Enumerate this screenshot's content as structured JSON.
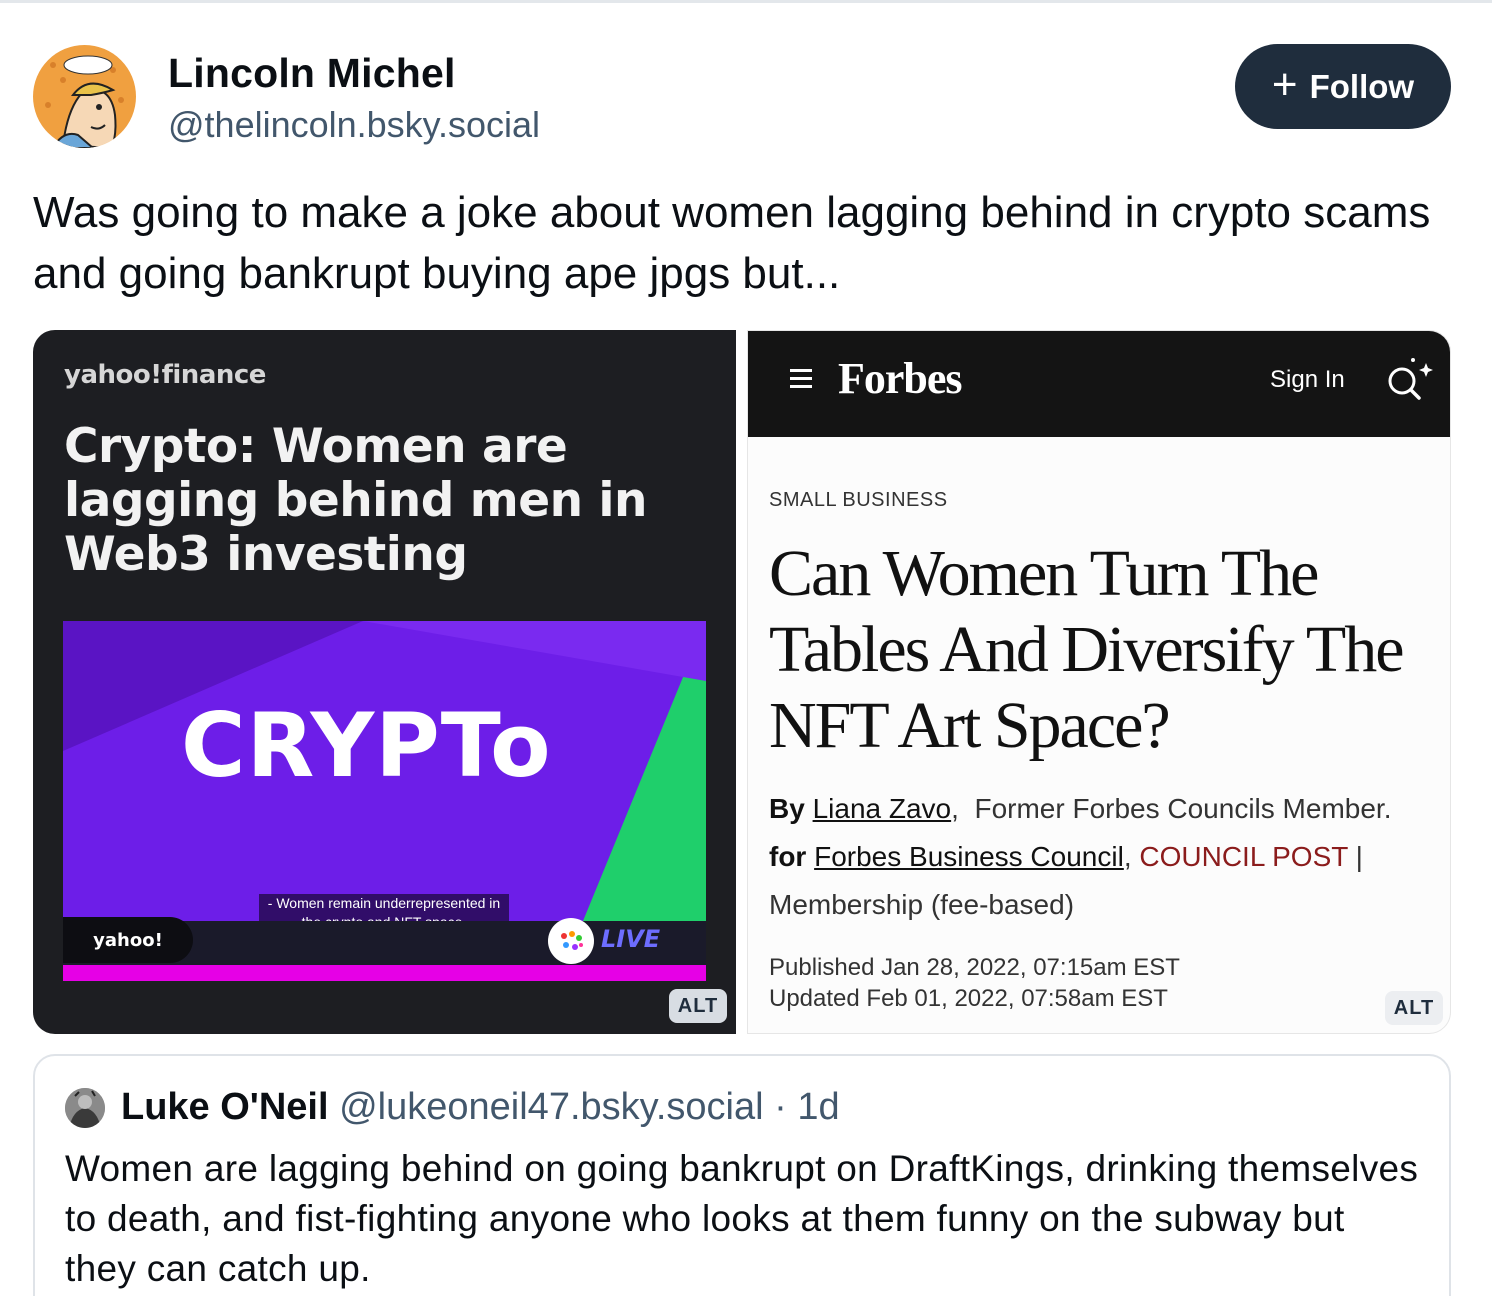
{
  "post": {
    "author_name": "Lincoln Michel",
    "author_handle": "@thelincoln.bsky.social",
    "follow_label": "Follow",
    "text": "Was going to make a joke about women lagging behind in crypto scams and going bankrupt buying ape jpgs but..."
  },
  "images": {
    "left": {
      "logo": "yahoo!finance",
      "headline": "Crypto: Women are lagging behind men in Web3 investing",
      "video_word": "CRYPTo",
      "caption": "- Women remain underrepresented in the crypto and NFT space,",
      "ticker_logo": "yahoo!",
      "live_label": "LIVE",
      "alt_label": "ALT"
    },
    "right": {
      "logo": "Forbes",
      "signin": "Sign In",
      "section": "SMALL BUSINESS",
      "headline": "Can Women Turn The Tables And Diversify The NFT Art Space?",
      "by_label": "By",
      "author": "Liana Zavo",
      "author_role": "Former Forbes Councils Member.",
      "for_label": "for",
      "council": "Forbes Business Council",
      "council_post": "COUNCIL POST",
      "membership": "Membership (fee-based)",
      "published": "Published Jan 28, 2022, 07:15am EST",
      "updated": "Updated Feb 01, 2022, 07:58am EST",
      "alt_label": "ALT"
    }
  },
  "quote": {
    "author_name": "Luke O'Neil",
    "author_handle": "@lukeoneil47.bsky.social",
    "time": "1d",
    "text": "Women are lagging behind on going bankrupt on DraftKings, drinking themselves to death, and fist-fighting anyone who looks at them funny on the subway but they can catch up."
  },
  "colors": {
    "follow_bg": "#1f2d3d",
    "handle": "#42576c",
    "crypto_purple": "#6d1ee8",
    "crypto_green": "#1fcf6b",
    "forbes_council": "#8b1c1c"
  }
}
